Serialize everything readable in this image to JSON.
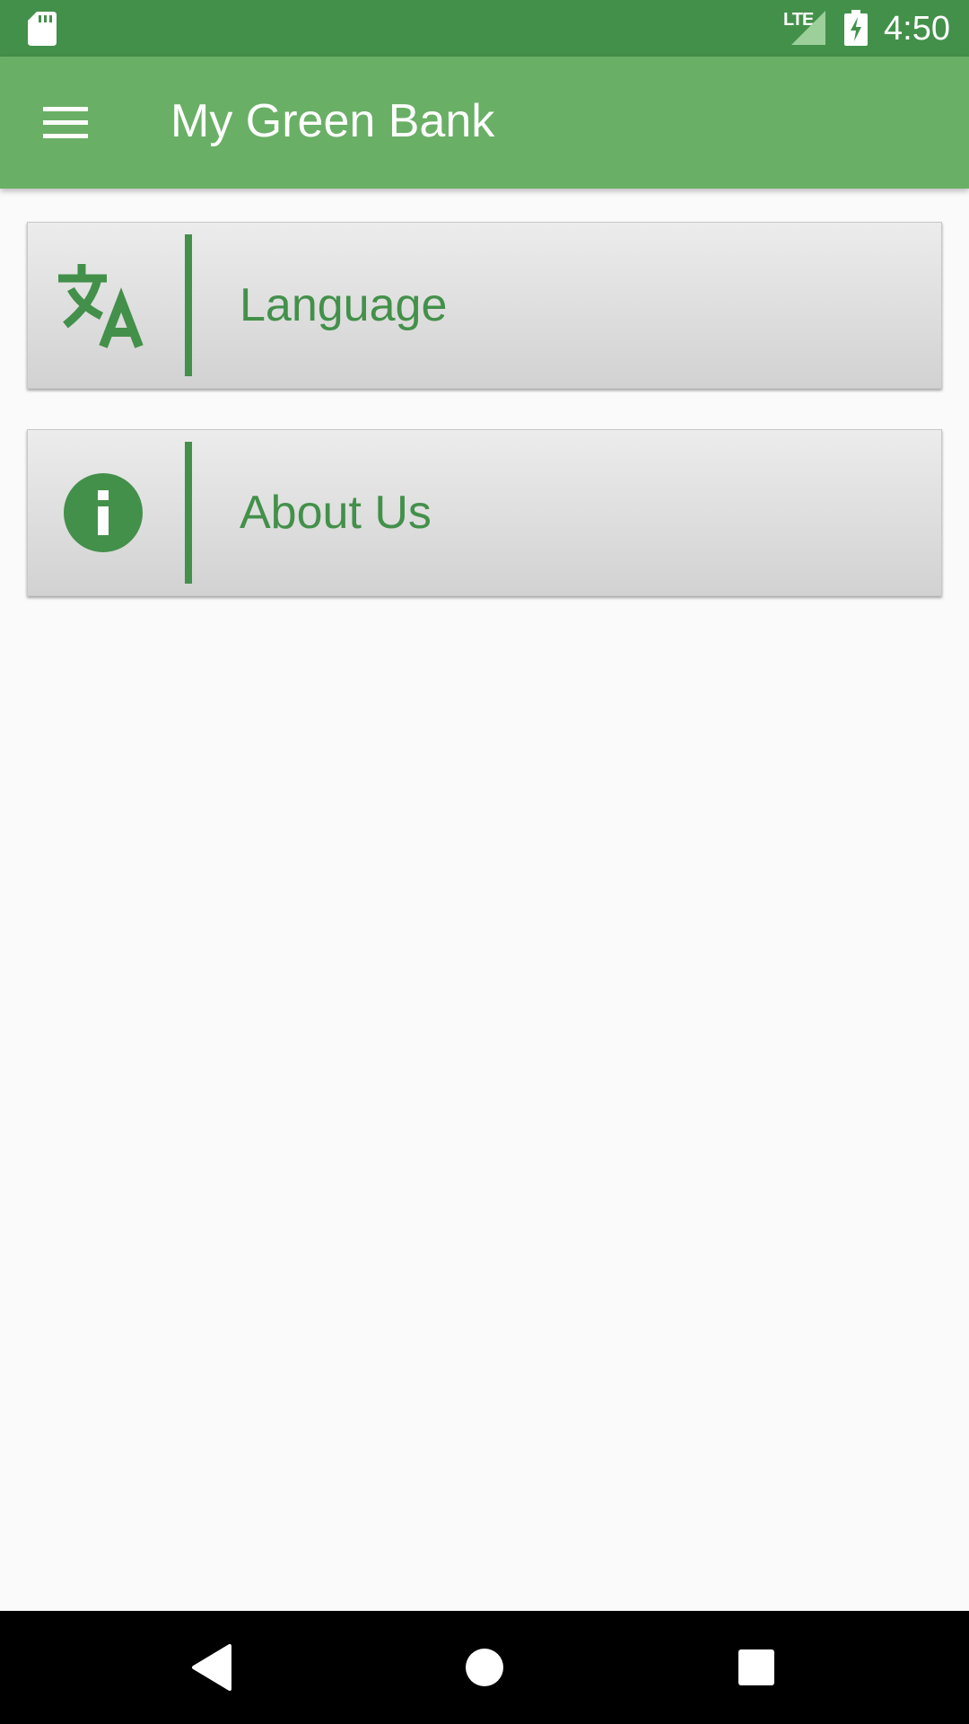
{
  "status_bar": {
    "network_label": "LTE",
    "time": "4:50",
    "icons": [
      "sd-card-icon",
      "signal-icon",
      "battery-charging-icon"
    ]
  },
  "app_bar": {
    "title": "My Green Bank",
    "menu_icon": "hamburger-menu-icon"
  },
  "menu": {
    "items": [
      {
        "label": "Language",
        "icon": "translate-icon"
      },
      {
        "label": "About Us",
        "icon": "info-icon"
      }
    ]
  },
  "nav_bar": {
    "buttons": [
      "back-icon",
      "home-icon",
      "recents-icon"
    ]
  },
  "colors": {
    "status_bar": "#43904a",
    "app_bar": "#6aaf66",
    "accent": "#43904a",
    "background": "#fafafa"
  }
}
